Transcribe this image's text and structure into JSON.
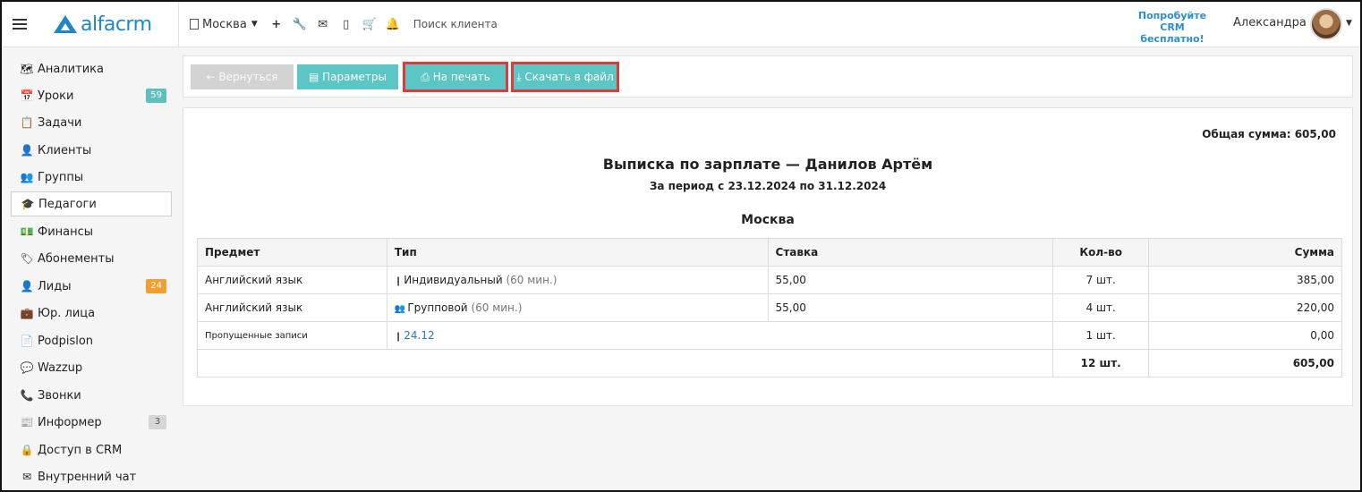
{
  "topbar": {
    "logo_text": "alfacrm",
    "branch": "Москва",
    "search_placeholder": "Поиск клиента",
    "promo_line1": "Попробуйте",
    "promo_line2": "CRM бесплатно!",
    "user_name": "Александра",
    "icons": [
      "plus-icon",
      "wrench-icon",
      "envelope-icon",
      "mobile-icon",
      "cart-icon",
      "bell-icon"
    ]
  },
  "sidebar": {
    "items": [
      {
        "label": "Аналитика",
        "icon": "map-icon"
      },
      {
        "label": "Уроки",
        "icon": "calendar-icon",
        "badge": "59"
      },
      {
        "label": "Задачи",
        "icon": "clipboard-icon"
      },
      {
        "label": "Клиенты",
        "icon": "user-icon"
      },
      {
        "label": "Группы",
        "icon": "users-icon"
      },
      {
        "label": "Педагоги",
        "icon": "graduation-cap-icon",
        "active": true
      },
      {
        "label": "Финансы",
        "icon": "money-icon"
      },
      {
        "label": "Абонементы",
        "icon": "tag-icon"
      },
      {
        "label": "Лиды",
        "icon": "user-plus-icon",
        "badge": "24"
      },
      {
        "label": "Юр. лица",
        "icon": "briefcase-icon"
      },
      {
        "label": "Podpislon",
        "icon": "file-icon"
      },
      {
        "label": "Wazzup",
        "icon": "whatsapp-icon"
      },
      {
        "label": "Звонки",
        "icon": "phone-icon"
      },
      {
        "label": "Информер",
        "icon": "newspaper-icon",
        "badge": "3"
      },
      {
        "label": "Доступ в CRM",
        "icon": "lock-icon"
      },
      {
        "label": "Внутренний чат",
        "icon": "envelope-icon"
      }
    ]
  },
  "toolbar": {
    "back_label": "← Вернуться",
    "params_label": "Параметры",
    "print_label": "На печать",
    "download_label": "Скачать в файл"
  },
  "report": {
    "total_label": "Общая сумма: 605,00",
    "title": "Выписка по зарплате — Данилов Артём",
    "period": "За период с 23.12.2024 по 31.12.2024",
    "branch": "Москва",
    "columns": [
      "Предмет",
      "Тип",
      "Ставка",
      "Кол-во",
      "Сумма"
    ],
    "rows": [
      {
        "subject": "Английский язык",
        "type": "Индивидуальный",
        "type_note": "(60 мин.)",
        "rate": "55,00",
        "qty": "7 шт.",
        "sum": "385,00"
      },
      {
        "subject": "Английский язык",
        "type": "Групповой",
        "type_note": "(60 мин.)",
        "rate": "55,00",
        "qty": "4 шт.",
        "sum": "220,00"
      }
    ],
    "missed": {
      "subject": "Пропущенные записи",
      "link": "24.12",
      "qty": "1 шт.",
      "sum": "0,00"
    },
    "totals": {
      "qty": "12 шт.",
      "sum": "605,00"
    }
  }
}
